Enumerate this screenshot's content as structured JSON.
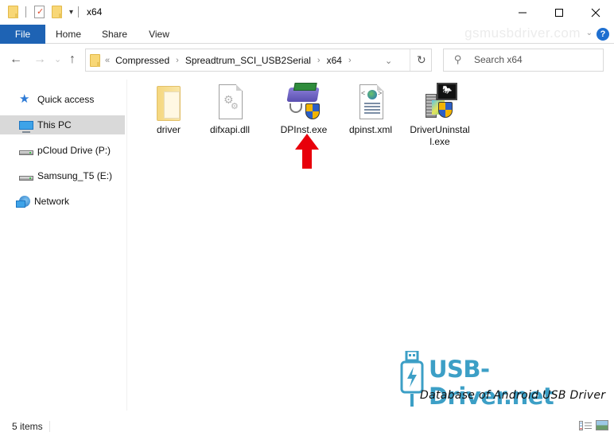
{
  "window": {
    "title": "x64",
    "controls": {
      "minimize": "—",
      "maximize": "☐",
      "close": "✕"
    }
  },
  "quick_access_toolbar": {
    "icons": [
      "folder-icon",
      "properties-icon",
      "new-folder-icon",
      "customize-dropdown-icon"
    ],
    "dropdown_glyph": "▾"
  },
  "ribbon": {
    "tabs": [
      {
        "label": "File",
        "active": true
      },
      {
        "label": "Home"
      },
      {
        "label": "Share"
      },
      {
        "label": "View"
      }
    ],
    "watermark": "gsmusbdriver.com",
    "expand_glyph": "⌄",
    "help_glyph": "?",
    "accent_color": "#1e63b4"
  },
  "navigation": {
    "back_glyph": "←",
    "forward_glyph": "→",
    "recent_glyph": "⌄",
    "up_glyph": "↑",
    "breadcrumb_lead": "«",
    "breadcrumb": [
      "Compressed",
      "Spreadtrum_SCI_USB2Serial",
      "x64"
    ],
    "breadcrumb_sep": "›",
    "dropdown_glyph": "⌄",
    "refresh_glyph": "↻",
    "search": {
      "placeholder": "Search x64",
      "value": "",
      "icon_glyph": "⚲"
    }
  },
  "sidebar": {
    "items": [
      {
        "label": "Quick access",
        "icon": "quick-access-star-icon"
      },
      {
        "label": "This PC",
        "icon": "this-pc-icon",
        "selected": true
      },
      {
        "label": "pCloud Drive (P:)",
        "icon": "drive-icon"
      },
      {
        "label": "Samsung_T5 (E:)",
        "icon": "drive-icon"
      },
      {
        "label": "Network",
        "icon": "network-icon"
      }
    ]
  },
  "files": [
    {
      "name": "driver",
      "type": "folder",
      "icon": "folder-icon"
    },
    {
      "name": "difxapi.dll",
      "type": "dll",
      "icon": "dll-gear-icon"
    },
    {
      "name": "DPInst.exe",
      "type": "exe",
      "icon": "device-installer-icon",
      "highlighted_by_arrow": true
    },
    {
      "name": "dpinst.xml",
      "type": "xml",
      "icon": "xml-document-icon"
    },
    {
      "name": "DriverUninstall.exe",
      "type": "exe",
      "icon": "uninstaller-icon"
    }
  ],
  "annotation": {
    "arrow_color": "#e8000b",
    "points_to": "DPInst.exe"
  },
  "watermark_logo": {
    "title": "USB-Driver.net",
    "subtitle": "Database of Android USB Driver",
    "color": "#3c9fc6"
  },
  "status_bar": {
    "item_count": "5 items",
    "views": [
      "details-view-icon",
      "large-icons-view-icon"
    ]
  }
}
